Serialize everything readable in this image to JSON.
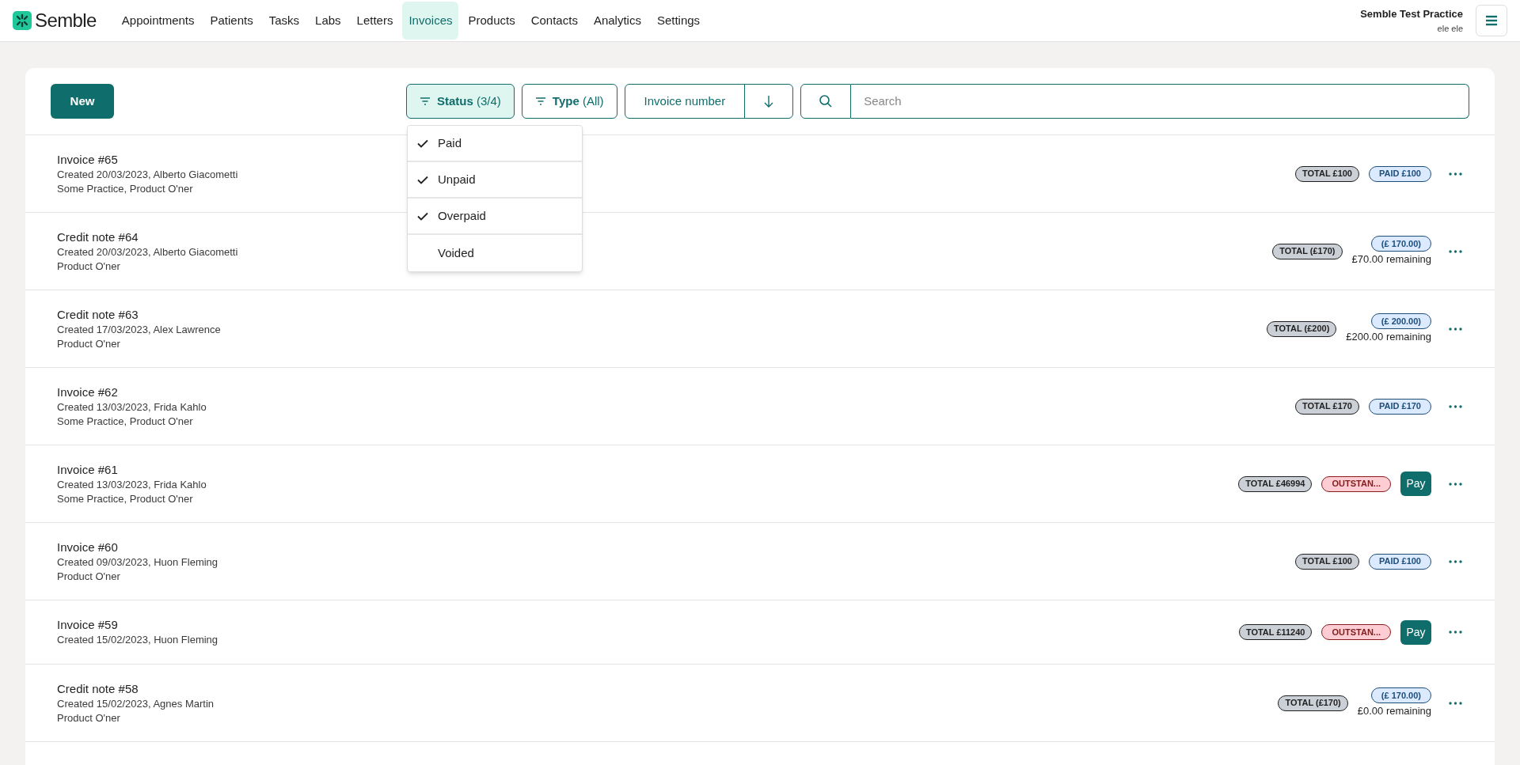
{
  "brand": "Semble",
  "nav": [
    {
      "label": "Appointments",
      "selected": false
    },
    {
      "label": "Patients",
      "selected": false
    },
    {
      "label": "Tasks",
      "selected": false
    },
    {
      "label": "Labs",
      "selected": false
    },
    {
      "label": "Letters",
      "selected": false
    },
    {
      "label": "Invoices",
      "selected": true
    },
    {
      "label": "Products",
      "selected": false
    },
    {
      "label": "Contacts",
      "selected": false
    },
    {
      "label": "Analytics",
      "selected": false
    },
    {
      "label": "Settings",
      "selected": false
    }
  ],
  "account": {
    "practice": "Semble Test Practice",
    "user": "ele ele"
  },
  "toolbar": {
    "new_button": "New",
    "filters": [
      {
        "label": "Status",
        "count": "(3/4)",
        "active": true
      },
      {
        "label": "Type",
        "count": "(All)",
        "active": false
      }
    ],
    "sort": {
      "label": "Invoice number"
    },
    "search": {
      "placeholder": "Search"
    }
  },
  "status_menu": [
    {
      "label": "Paid",
      "checked": true
    },
    {
      "label": "Unpaid",
      "checked": true
    },
    {
      "label": "Overpaid",
      "checked": true
    },
    {
      "label": "Voided",
      "checked": false
    }
  ],
  "invoices": [
    {
      "title": "Invoice #65",
      "lines": [
        "Created 20/03/2023, Alberto Giacometti",
        "Some Practice, Product O'ner"
      ],
      "total": "TOTAL £100",
      "status": {
        "kind": "paid",
        "label": "PAID £100"
      }
    },
    {
      "title": "Credit note #64",
      "lines": [
        "Created 20/03/2023, Alberto Giacometti",
        "Product O'ner"
      ],
      "total": "TOTAL (£170)",
      "status": {
        "kind": "paid",
        "label": "(£ 170.00)"
      },
      "remaining": "£70.00 remaining"
    },
    {
      "title": "Credit note #63",
      "lines": [
        "Created 17/03/2023, Alex Lawrence",
        "Product O'ner"
      ],
      "total": "TOTAL (£200)",
      "status": {
        "kind": "paid",
        "label": "(£ 200.00)"
      },
      "remaining": "£200.00 remaining"
    },
    {
      "title": "Invoice #62",
      "lines": [
        "Created 13/03/2023, Frida Kahlo",
        "Some Practice, Product O'ner"
      ],
      "total": "TOTAL £170",
      "status": {
        "kind": "paid",
        "label": "PAID £170"
      }
    },
    {
      "title": "Invoice #61",
      "lines": [
        "Created 13/03/2023, Frida Kahlo",
        "Some Practice, Product O'ner"
      ],
      "total": "TOTAL £46994",
      "status": {
        "kind": "outstanding",
        "label": "OUTSTAN..."
      },
      "pay": "Pay"
    },
    {
      "title": "Invoice #60",
      "lines": [
        "Created 09/03/2023, Huon Fleming",
        "Product O'ner"
      ],
      "total": "TOTAL £100",
      "status": {
        "kind": "paid",
        "label": "PAID £100"
      }
    },
    {
      "title": "Invoice #59",
      "lines": [
        "Created 15/02/2023, Huon Fleming"
      ],
      "total": "TOTAL £11240",
      "status": {
        "kind": "outstanding",
        "label": "OUTSTAN..."
      },
      "pay": "Pay"
    },
    {
      "title": "Credit note #58",
      "lines": [
        "Created 15/02/2023, Agnes Martin",
        "Product O'ner"
      ],
      "total": "TOTAL (£170)",
      "status": {
        "kind": "paid",
        "label": "(£ 170.00)"
      },
      "remaining": "£0.00 remaining"
    }
  ]
}
